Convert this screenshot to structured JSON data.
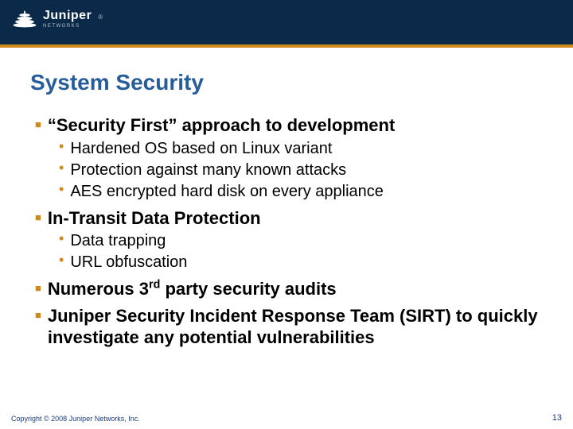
{
  "header": {
    "brand": "Juniper",
    "tagline": "NETWORKS",
    "registered": "®"
  },
  "title": "System Security",
  "bullets": [
    {
      "heading": "“Security First” approach to development",
      "sub": [
        "Hardened OS based on Linux variant",
        "Protection against many known attacks",
        "AES encrypted hard disk on every appliance"
      ]
    },
    {
      "heading": "In-Transit Data Protection",
      "sub": [
        "Data trapping",
        "URL obfuscation"
      ]
    },
    {
      "heading_pre": "Numerous 3",
      "heading_sup": "rd",
      "heading_post": " party security audits",
      "sub": []
    },
    {
      "heading": "Juniper Security Incident Response Team (SIRT) to quickly investigate any potential vulnerabilities",
      "sub": []
    }
  ],
  "footer": {
    "copyright": "Copyright © 2008 Juniper Networks, Inc.",
    "page": "13"
  }
}
